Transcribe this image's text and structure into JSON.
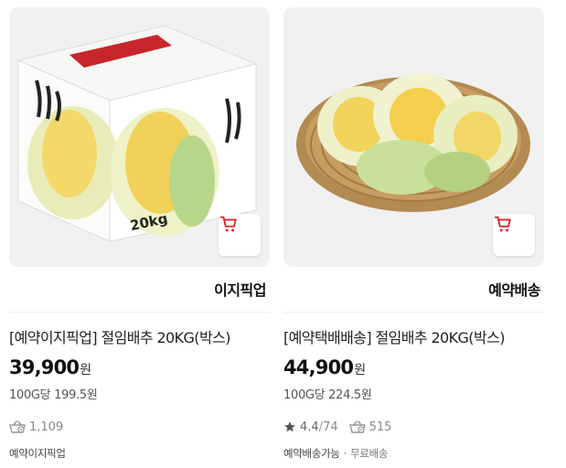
{
  "products": [
    {
      "image_alt": "절임배추 박스",
      "shipping_type": "이지픽업",
      "title": "[예약이지픽업] 절임배추 20KG(박스)",
      "price": "39,900",
      "currency": "원",
      "unit_price": "100G당 199.5원",
      "review_count": "1,109",
      "footer": [
        "예약이지픽업"
      ]
    },
    {
      "image_alt": "절임배추 바구니",
      "shipping_type": "예약배송",
      "title": "[예약택배배송] 절임배추 20KG(박스)",
      "price": "44,900",
      "currency": "원",
      "unit_price": "100G당 224.5원",
      "rating": "4.4",
      "rating_count": "74",
      "rating_sep": "/",
      "review_count": "515",
      "footer": [
        "예약배송가능",
        "무료배송"
      ]
    }
  ],
  "box_label": "20kg",
  "icons": {
    "cart": "cart-icon",
    "review": "basket-icon",
    "star": "star-icon"
  },
  "colors": {
    "cart_accent": "#e0202b",
    "thumb_bg": "#f1f1f1",
    "star": "#555555"
  }
}
